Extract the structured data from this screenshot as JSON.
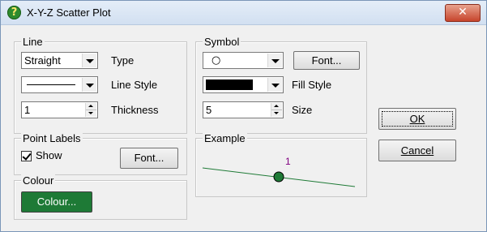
{
  "window": {
    "title": "X-Y-Z Scatter Plot",
    "close_label": "✕"
  },
  "line_group": {
    "legend": "Line",
    "type_value": "Straight",
    "type_label": "Type",
    "style_label": "Line Style",
    "thickness_value": "1",
    "thickness_label": "Thickness"
  },
  "symbol_group": {
    "legend": "Symbol",
    "symbol_value": "○",
    "font_button": "Font...",
    "fill_label": "Fill Style",
    "size_value": "5",
    "size_label": "Size"
  },
  "point_labels_group": {
    "legend": "Point Labels",
    "show_label": "Show",
    "show_checked": true,
    "font_button": "Font..."
  },
  "colour_group": {
    "legend": "Colour",
    "colour_button": "Colour...",
    "colour_hex": "#1e7a36"
  },
  "example_group": {
    "legend": "Example",
    "point_label": "1",
    "line_color": "#1e7a36",
    "point_color": "#1e7a36",
    "label_color": "#800080"
  },
  "buttons": {
    "ok": "OK",
    "cancel": "Cancel"
  }
}
